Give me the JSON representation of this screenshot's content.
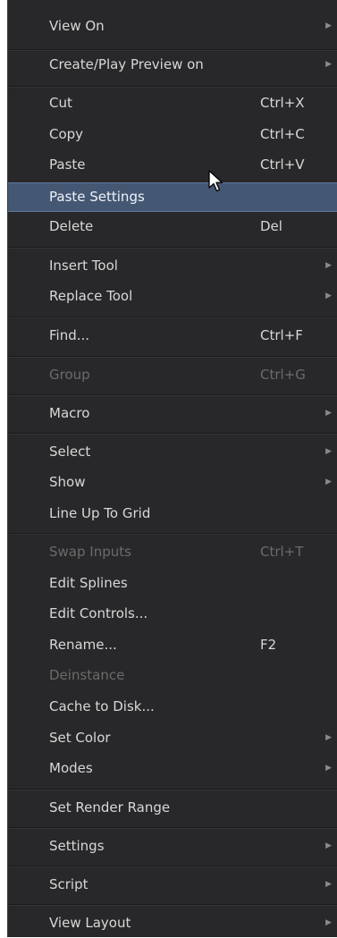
{
  "menu": {
    "items": [
      {
        "label": "View On",
        "shortcut": "",
        "submenu": true,
        "disabled": false
      },
      {
        "label": "Create/Play Preview on",
        "shortcut": "",
        "submenu": true,
        "disabled": false
      },
      {
        "label": "Cut",
        "shortcut": "Ctrl+X",
        "submenu": false,
        "disabled": false
      },
      {
        "label": "Copy",
        "shortcut": "Ctrl+C",
        "submenu": false,
        "disabled": false
      },
      {
        "label": "Paste",
        "shortcut": "Ctrl+V",
        "submenu": false,
        "disabled": false
      },
      {
        "label": "Paste Settings",
        "shortcut": "",
        "submenu": false,
        "disabled": false,
        "highlighted": true
      },
      {
        "label": "Delete",
        "shortcut": "Del",
        "submenu": false,
        "disabled": false
      },
      {
        "label": "Insert Tool",
        "shortcut": "",
        "submenu": true,
        "disabled": false
      },
      {
        "label": "Replace Tool",
        "shortcut": "",
        "submenu": true,
        "disabled": false
      },
      {
        "label": "Find...",
        "shortcut": "Ctrl+F",
        "submenu": false,
        "disabled": false
      },
      {
        "label": "Group",
        "shortcut": "Ctrl+G",
        "submenu": false,
        "disabled": true
      },
      {
        "label": "Macro",
        "shortcut": "",
        "submenu": true,
        "disabled": false
      },
      {
        "label": "Select",
        "shortcut": "",
        "submenu": true,
        "disabled": false
      },
      {
        "label": "Show",
        "shortcut": "",
        "submenu": true,
        "disabled": false
      },
      {
        "label": "Line Up To Grid",
        "shortcut": "",
        "submenu": false,
        "disabled": false
      },
      {
        "label": "Swap Inputs",
        "shortcut": "Ctrl+T",
        "submenu": false,
        "disabled": true
      },
      {
        "label": "Edit Splines",
        "shortcut": "",
        "submenu": false,
        "disabled": false
      },
      {
        "label": "Edit Controls...",
        "shortcut": "",
        "submenu": false,
        "disabled": false
      },
      {
        "label": "Rename...",
        "shortcut": "F2",
        "submenu": false,
        "disabled": false
      },
      {
        "label": "Deinstance",
        "shortcut": "",
        "submenu": false,
        "disabled": true
      },
      {
        "label": "Cache to Disk...",
        "shortcut": "",
        "submenu": false,
        "disabled": false
      },
      {
        "label": "Set Color",
        "shortcut": "",
        "submenu": true,
        "disabled": false
      },
      {
        "label": "Modes",
        "shortcut": "",
        "submenu": true,
        "disabled": false
      },
      {
        "label": "Set Render Range",
        "shortcut": "",
        "submenu": false,
        "disabled": false
      },
      {
        "label": "Settings",
        "shortcut": "",
        "submenu": true,
        "disabled": false
      },
      {
        "label": "Script",
        "shortcut": "",
        "submenu": true,
        "disabled": false
      },
      {
        "label": "View Layout",
        "shortcut": "",
        "submenu": true,
        "disabled": false
      }
    ],
    "submenu_arrow_icon": "triangle-right-icon",
    "pointer_icon": "mouse-pointer-icon"
  },
  "colors": {
    "menu_background": "#28282a",
    "highlight_background": "#445773",
    "text": "#d8d8d8",
    "disabled_text": "#6b6b6b"
  }
}
